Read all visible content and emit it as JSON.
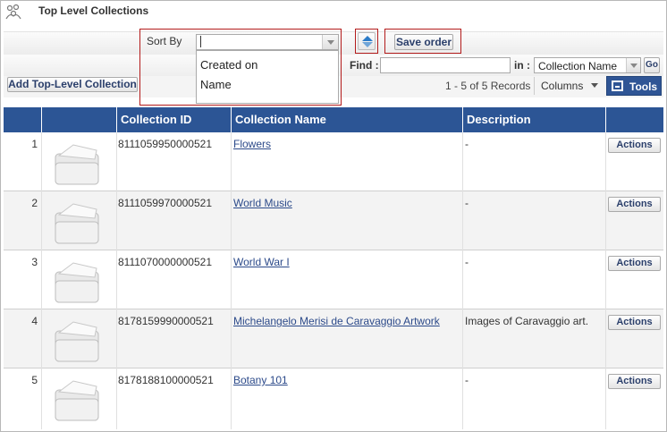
{
  "header": {
    "title": "Top Level Collections",
    "icon": "collections-icon"
  },
  "sort": {
    "label": "Sort By",
    "value": "",
    "options": [
      "Created on",
      "Name"
    ],
    "direction_icon": "sort-direction-icon"
  },
  "toolbar": {
    "save_order": "Save order",
    "find_label": "Find :",
    "find_value": "",
    "in_label": "in :",
    "in_value": "Collection Name",
    "go": "Go",
    "add_collection": "Add Top-Level Collection",
    "records": "1 - 5 of 5 Records",
    "columns": "Columns",
    "tools": "Tools"
  },
  "table": {
    "headers": [
      "Collection ID",
      "Collection Name",
      "Description"
    ],
    "rows": [
      {
        "num": "1",
        "id": "8111059950000521",
        "name": "Flowers",
        "description": "-",
        "action": "Actions"
      },
      {
        "num": "2",
        "id": "8111059970000521",
        "name": "World Music",
        "description": "-",
        "action": "Actions"
      },
      {
        "num": "3",
        "id": "8111070000000521",
        "name": "World War I",
        "description": "-",
        "action": "Actions"
      },
      {
        "num": "4",
        "id": "8178159990000521",
        "name": "Michelangelo Merisi de Caravaggio Artwork",
        "description": "Images of Caravaggio art.",
        "action": "Actions"
      },
      {
        "num": "5",
        "id": "8178188100000521",
        "name": "Botany 101",
        "description": "-",
        "action": "Actions"
      }
    ]
  },
  "colors": {
    "header_blue": "#2c5595",
    "highlight_red": "#b31b1b",
    "link": "#2c4a8a"
  }
}
